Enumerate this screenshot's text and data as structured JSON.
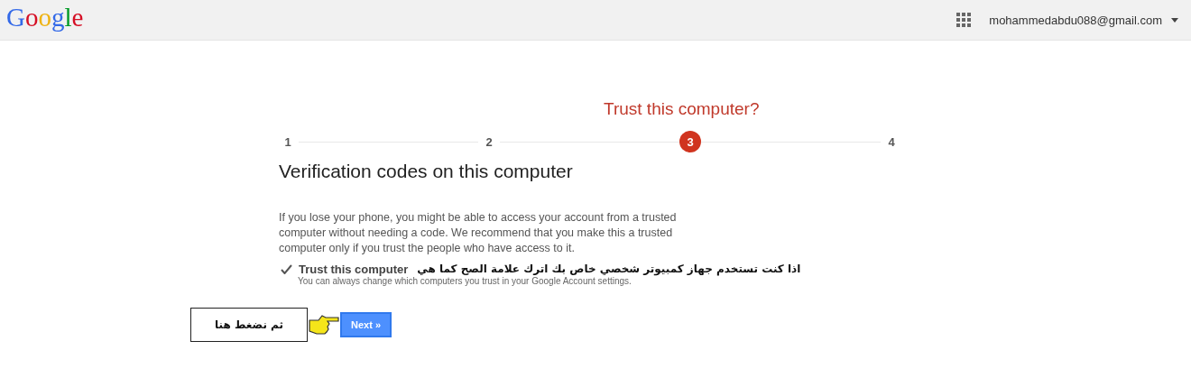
{
  "header": {
    "logo": "Google",
    "account": "mohammedabdu088@gmail.com"
  },
  "steps": [
    {
      "number": "1",
      "selected": false
    },
    {
      "number": "2",
      "selected": false
    },
    {
      "number": "3",
      "selected": true,
      "title": "Trust this computer?"
    },
    {
      "number": "4",
      "selected": false
    }
  ],
  "heading": "Verification codes on this computer",
  "description": "If you lose your phone, you might be able to access your account from a trusted computer without needing a code. We recommend that you make this a trusted computer only if you trust the people who have access to it.",
  "trust": {
    "label": "Trust this computer",
    "checked": true,
    "hint": "You can always change which computers you trust in your Google Account settings."
  },
  "annotations": {
    "checkbox_note": "اذا كنت تستخدم جهاز كمبيوتر شخصي خاص بك اترك علامة الصح كما هي",
    "button_note": "ثم نضغط هنا"
  },
  "next_button": "Next »"
}
